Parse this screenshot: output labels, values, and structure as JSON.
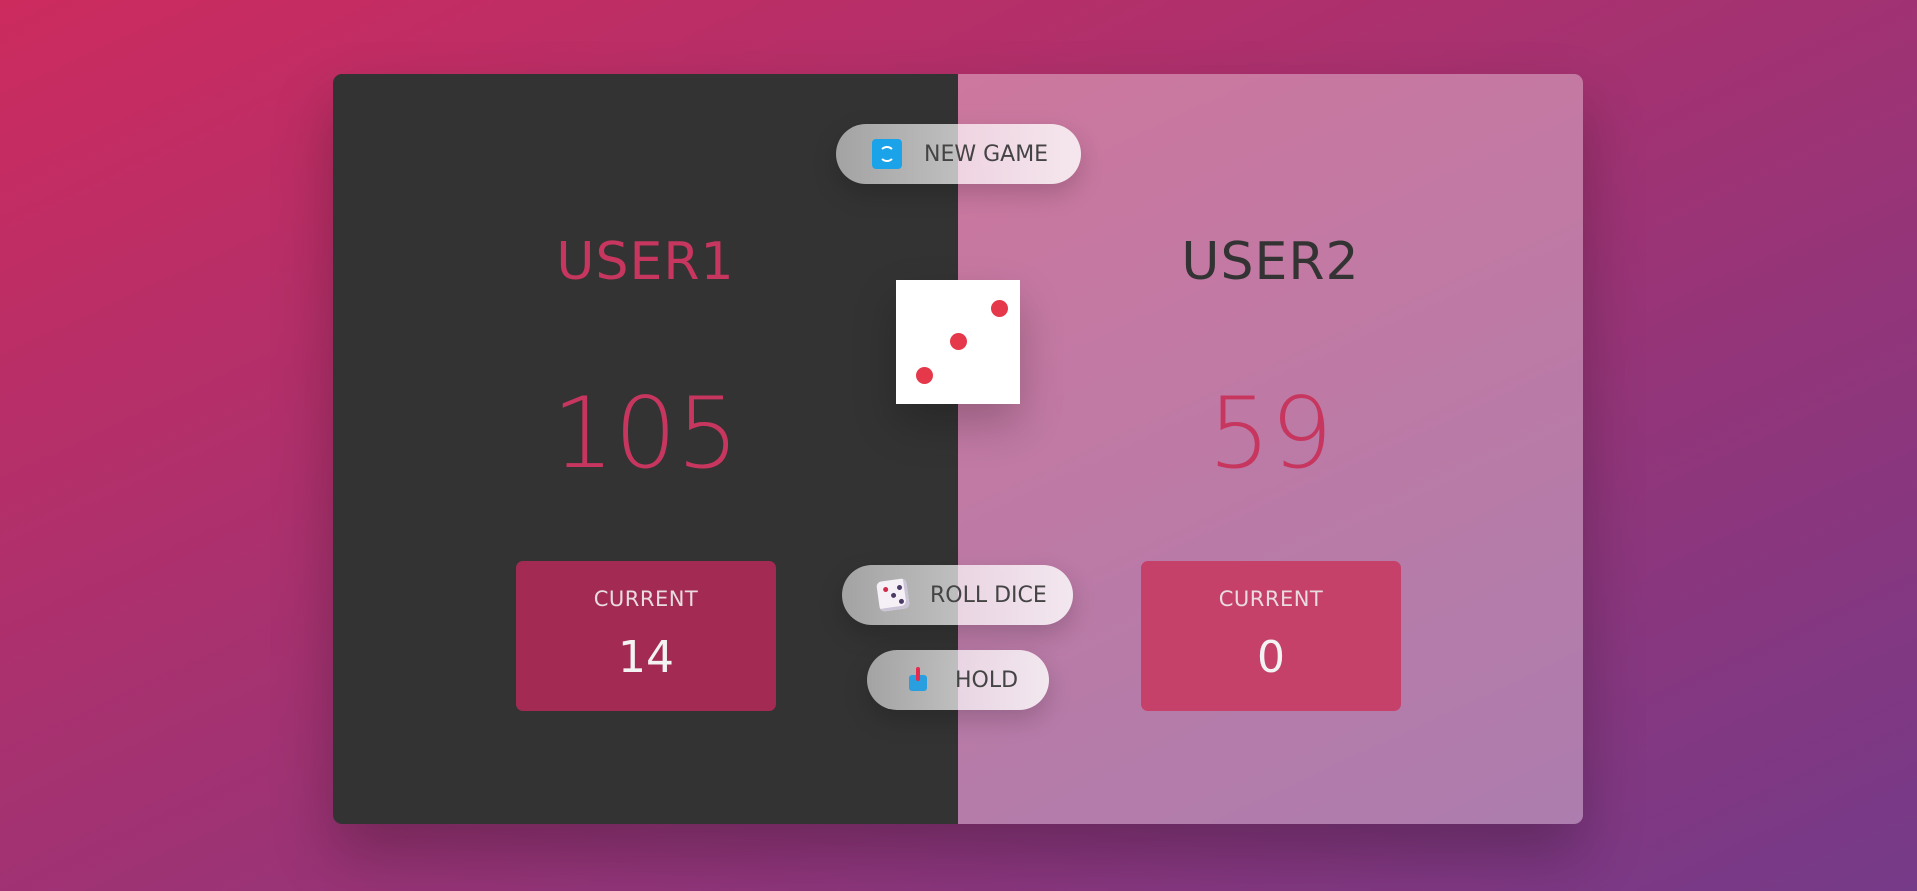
{
  "players": [
    {
      "name": "USER1",
      "score": "105",
      "current_label": "CURRENT",
      "current_score": "14",
      "active": true
    },
    {
      "name": "USER2",
      "score": "59",
      "current_label": "CURRENT",
      "current_score": "0",
      "active": false
    }
  ],
  "controls": {
    "new_game": {
      "label": "NEW GAME",
      "icon": "refresh-icon"
    },
    "roll_dice": {
      "label": "ROLL DICE",
      "icon": "dice-icon"
    },
    "hold": {
      "label": "HOLD",
      "icon": "inbox-tray-icon"
    }
  },
  "dice": {
    "value": 3
  },
  "colors": {
    "accent": "#c7365f",
    "active_panel": "#333333",
    "pip": "#e5384a",
    "bg_gradient_start": "#cc2b5e",
    "bg_gradient_end": "#753a88"
  }
}
